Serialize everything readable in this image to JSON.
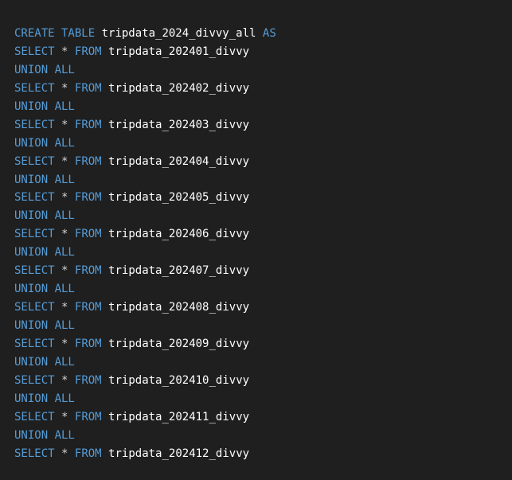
{
  "editor": {
    "theme": {
      "background": "#1f1f1f",
      "keyword": "#569cd6",
      "identifier": "#ffffff",
      "operator": "#d4d4d4"
    },
    "header": {
      "kw_create_table": "CREATE TABLE",
      "table_name": "tripdata_2024_divvy_all",
      "kw_as": "AS"
    },
    "kw_select": "SELECT",
    "op_star": "*",
    "kw_from": "FROM",
    "kw_union_all": "UNION ALL",
    "selects": [
      {
        "table": "tripdata_202401_divvy"
      },
      {
        "table": "tripdata_202402_divvy"
      },
      {
        "table": "tripdata_202403_divvy"
      },
      {
        "table": "tripdata_202404_divvy"
      },
      {
        "table": "tripdata_202405_divvy"
      },
      {
        "table": "tripdata_202406_divvy"
      },
      {
        "table": "tripdata_202407_divvy"
      },
      {
        "table": "tripdata_202408_divvy"
      },
      {
        "table": "tripdata_202409_divvy"
      },
      {
        "table": "tripdata_202410_divvy"
      },
      {
        "table": "tripdata_202411_divvy"
      },
      {
        "table": "tripdata_202412_divvy"
      }
    ]
  }
}
